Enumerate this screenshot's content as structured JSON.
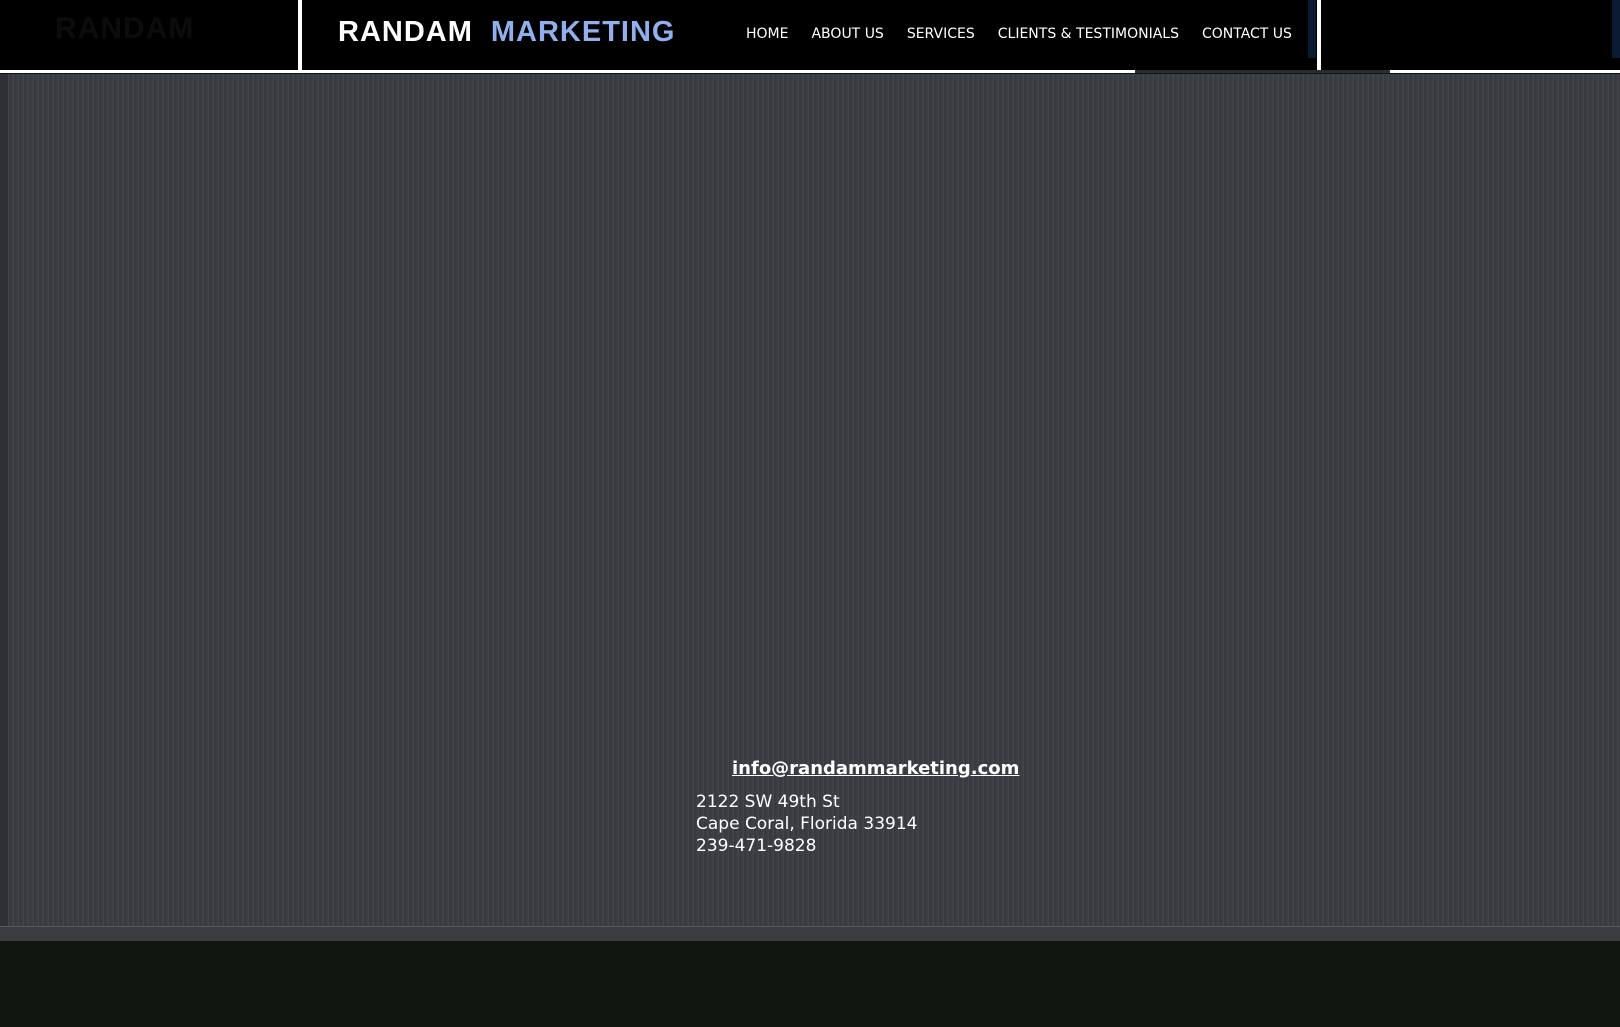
{
  "header": {
    "ghost_logo": "RANDAM",
    "logo_word1": "RANDAM",
    "logo_word2": "MARKETING",
    "logo_accent_color": "#8fb0ec"
  },
  "nav": {
    "items": [
      {
        "label": "HOME"
      },
      {
        "label": "ABOUT US"
      },
      {
        "label": "SERVICES"
      },
      {
        "label": "CLIENTS & TESTIMONIALS"
      },
      {
        "label": "CONTACT US"
      }
    ]
  },
  "contact": {
    "email": "info@randammarketing.com",
    "address_line1": "2122 SW 49th St",
    "address_line2": "Cape Coral, Florida  33914",
    "phone": "239-471-9828"
  },
  "colors": {
    "topbar": "#000000",
    "panel": "#3b3e43",
    "footer": "#111611"
  }
}
